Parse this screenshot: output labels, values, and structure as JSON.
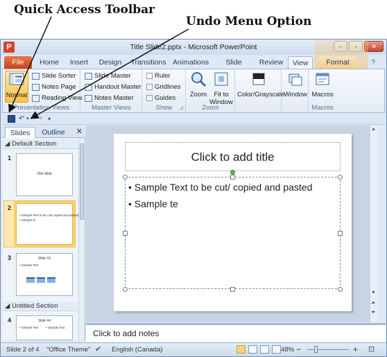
{
  "annotations": {
    "quick_access": "Quick Access Toolbar",
    "undo": "Undo Menu Option"
  },
  "window": {
    "app_icon": "P",
    "title": "Title Slide2.pptx - Microsoft PowerPoint",
    "min": "–",
    "restore": "▫",
    "close": "✕"
  },
  "tabs": {
    "file": "File",
    "home": "Home",
    "insert": "Insert",
    "design": "Design",
    "transitions": "Transitions",
    "animations": "Animations",
    "slide_show": "Slide Show",
    "review": "Review",
    "view": "View",
    "format": "Format",
    "help": "?"
  },
  "ribbon": {
    "presentation_views": {
      "label": "Presentation Views",
      "normal": "Normal",
      "slide_sorter": "Slide Sorter",
      "notes_page": "Notes Page",
      "reading_view": "Reading View"
    },
    "master_views": {
      "label": "Master Views",
      "slide_master": "Slide Master",
      "handout_master": "Handout Master",
      "notes_master": "Notes Master"
    },
    "show": {
      "label": "Show",
      "ruler": "Ruler",
      "gridlines": "Gridlines",
      "guides": "Guides"
    },
    "zoom": {
      "label": "Zoom",
      "zoom": "Zoom",
      "fit_to_window": "Fit to Window"
    },
    "color": {
      "color_grayscale": "Color/Grayscale"
    },
    "window": {
      "window": "Window"
    },
    "macros": {
      "label": "Macros",
      "macros": "Macros"
    }
  },
  "pane": {
    "tab_slides": "Slides",
    "tab_outline": "Outline",
    "close": "✕",
    "section1": "Default Section",
    "section2": "Untitled Section",
    "slides": [
      {
        "num": "1",
        "title": "Title Slide"
      },
      {
        "num": "2",
        "bullets": [
          "• Sample Text to be cut/ copied and pasted",
          "• Sample te"
        ]
      },
      {
        "num": "3",
        "title": "Slide #3",
        "bullets": [
          "• Sample Text"
        ]
      },
      {
        "num": "4",
        "title": "Slide #4",
        "bullets": [
          "• Sample Text",
          "• Sample Text"
        ]
      }
    ]
  },
  "slide": {
    "title_placeholder": "Click to add title",
    "bullet1": "Sample Text to be cut/ copied and pasted",
    "bullet2": "Sample te"
  },
  "notes_placeholder": "Click to add notes",
  "status": {
    "slide_of": "Slide 2 of 4",
    "theme": "\"Office Theme\"",
    "language": "English (Canada)",
    "zoom": "48%",
    "zoom_minus": "−",
    "zoom_plus": "+"
  },
  "colors": {
    "accent_file_tab": "#d24726",
    "ribbon_bg": "#e3ebf5",
    "selected_highlight": "#f6c24d"
  }
}
